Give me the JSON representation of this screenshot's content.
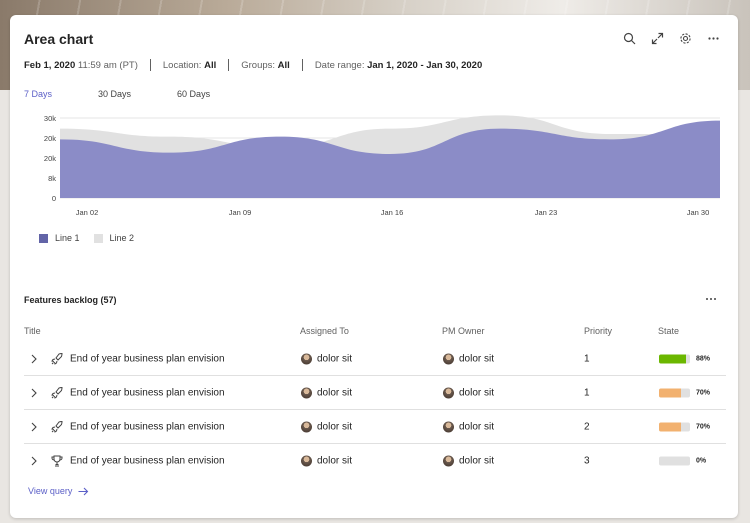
{
  "card": {
    "title": "Area chart",
    "icons": [
      "search-icon",
      "expand-icon",
      "gear-icon",
      "more-icon"
    ]
  },
  "meta": {
    "date": "Feb 1, 2020",
    "time": "11:59 am (PT)",
    "location_label": "Location:",
    "location_value": "All",
    "groups_label": "Groups:",
    "groups_value": "All",
    "range_label": "Date range:",
    "range_value": "Jan 1, 2020 - Jan 30, 2020"
  },
  "tabs": [
    {
      "label": "7 Days",
      "active": true
    },
    {
      "label": "30 Days",
      "active": false
    },
    {
      "label": "60 Days",
      "active": false
    }
  ],
  "colors": {
    "accent": "#5b5fc7",
    "line1": "#8b8cc7",
    "line1_legend": "#6264a7",
    "line2": "#e1e1e1",
    "state_green": "#6bb700",
    "state_orange": "#f2b16f"
  },
  "chart_data": {
    "type": "area",
    "x": [
      "Jan 02",
      "Jan 09",
      "Jan 16",
      "Jan 23",
      "Jan 30"
    ],
    "xticks": [
      "Jan 02",
      "Jan 09",
      "Jan 16",
      "Jan 23",
      "Jan 30"
    ],
    "yticks": [
      "0",
      "8k",
      "20k",
      "20k",
      "30k"
    ],
    "ylim": [
      0,
      30000
    ],
    "series": [
      {
        "name": "Line 1",
        "values": [
          22000,
          17000,
          23000,
          16500,
          26000,
          22000,
          29000
        ]
      },
      {
        "name": "Line 2",
        "values": [
          26000,
          23000,
          19000,
          26000,
          31000,
          24000,
          24000
        ]
      }
    ],
    "legend_position": "bottom-left",
    "grid": true
  },
  "backlog": {
    "title": "Features backlog (57)",
    "columns": [
      "Title",
      "Assigned To",
      "PM Owner",
      "Priority",
      "State"
    ],
    "rows": [
      {
        "icon": "rocket-icon",
        "title": "End of year business plan envision",
        "assigned": "dolor sit",
        "owner": "dolor sit",
        "priority": "1",
        "state_pct": "88%",
        "state_value": 88,
        "state_color": "#6bb700"
      },
      {
        "icon": "rocket-icon",
        "title": "End of year business plan envision",
        "assigned": "dolor sit",
        "owner": "dolor sit",
        "priority": "1",
        "state_pct": "70%",
        "state_value": 70,
        "state_color": "#f2b16f"
      },
      {
        "icon": "rocket-icon",
        "title": "End of year business plan envision",
        "assigned": "dolor sit",
        "owner": "dolor sit",
        "priority": "2",
        "state_pct": "70%",
        "state_value": 70,
        "state_color": "#f2b16f"
      },
      {
        "icon": "trophy-icon",
        "title": "End of year business plan envision",
        "assigned": "dolor sit",
        "owner": "dolor sit",
        "priority": "3",
        "state_pct": "0%",
        "state_value": 0,
        "state_color": "#e0e0e0"
      }
    ],
    "view_query": "View query"
  }
}
